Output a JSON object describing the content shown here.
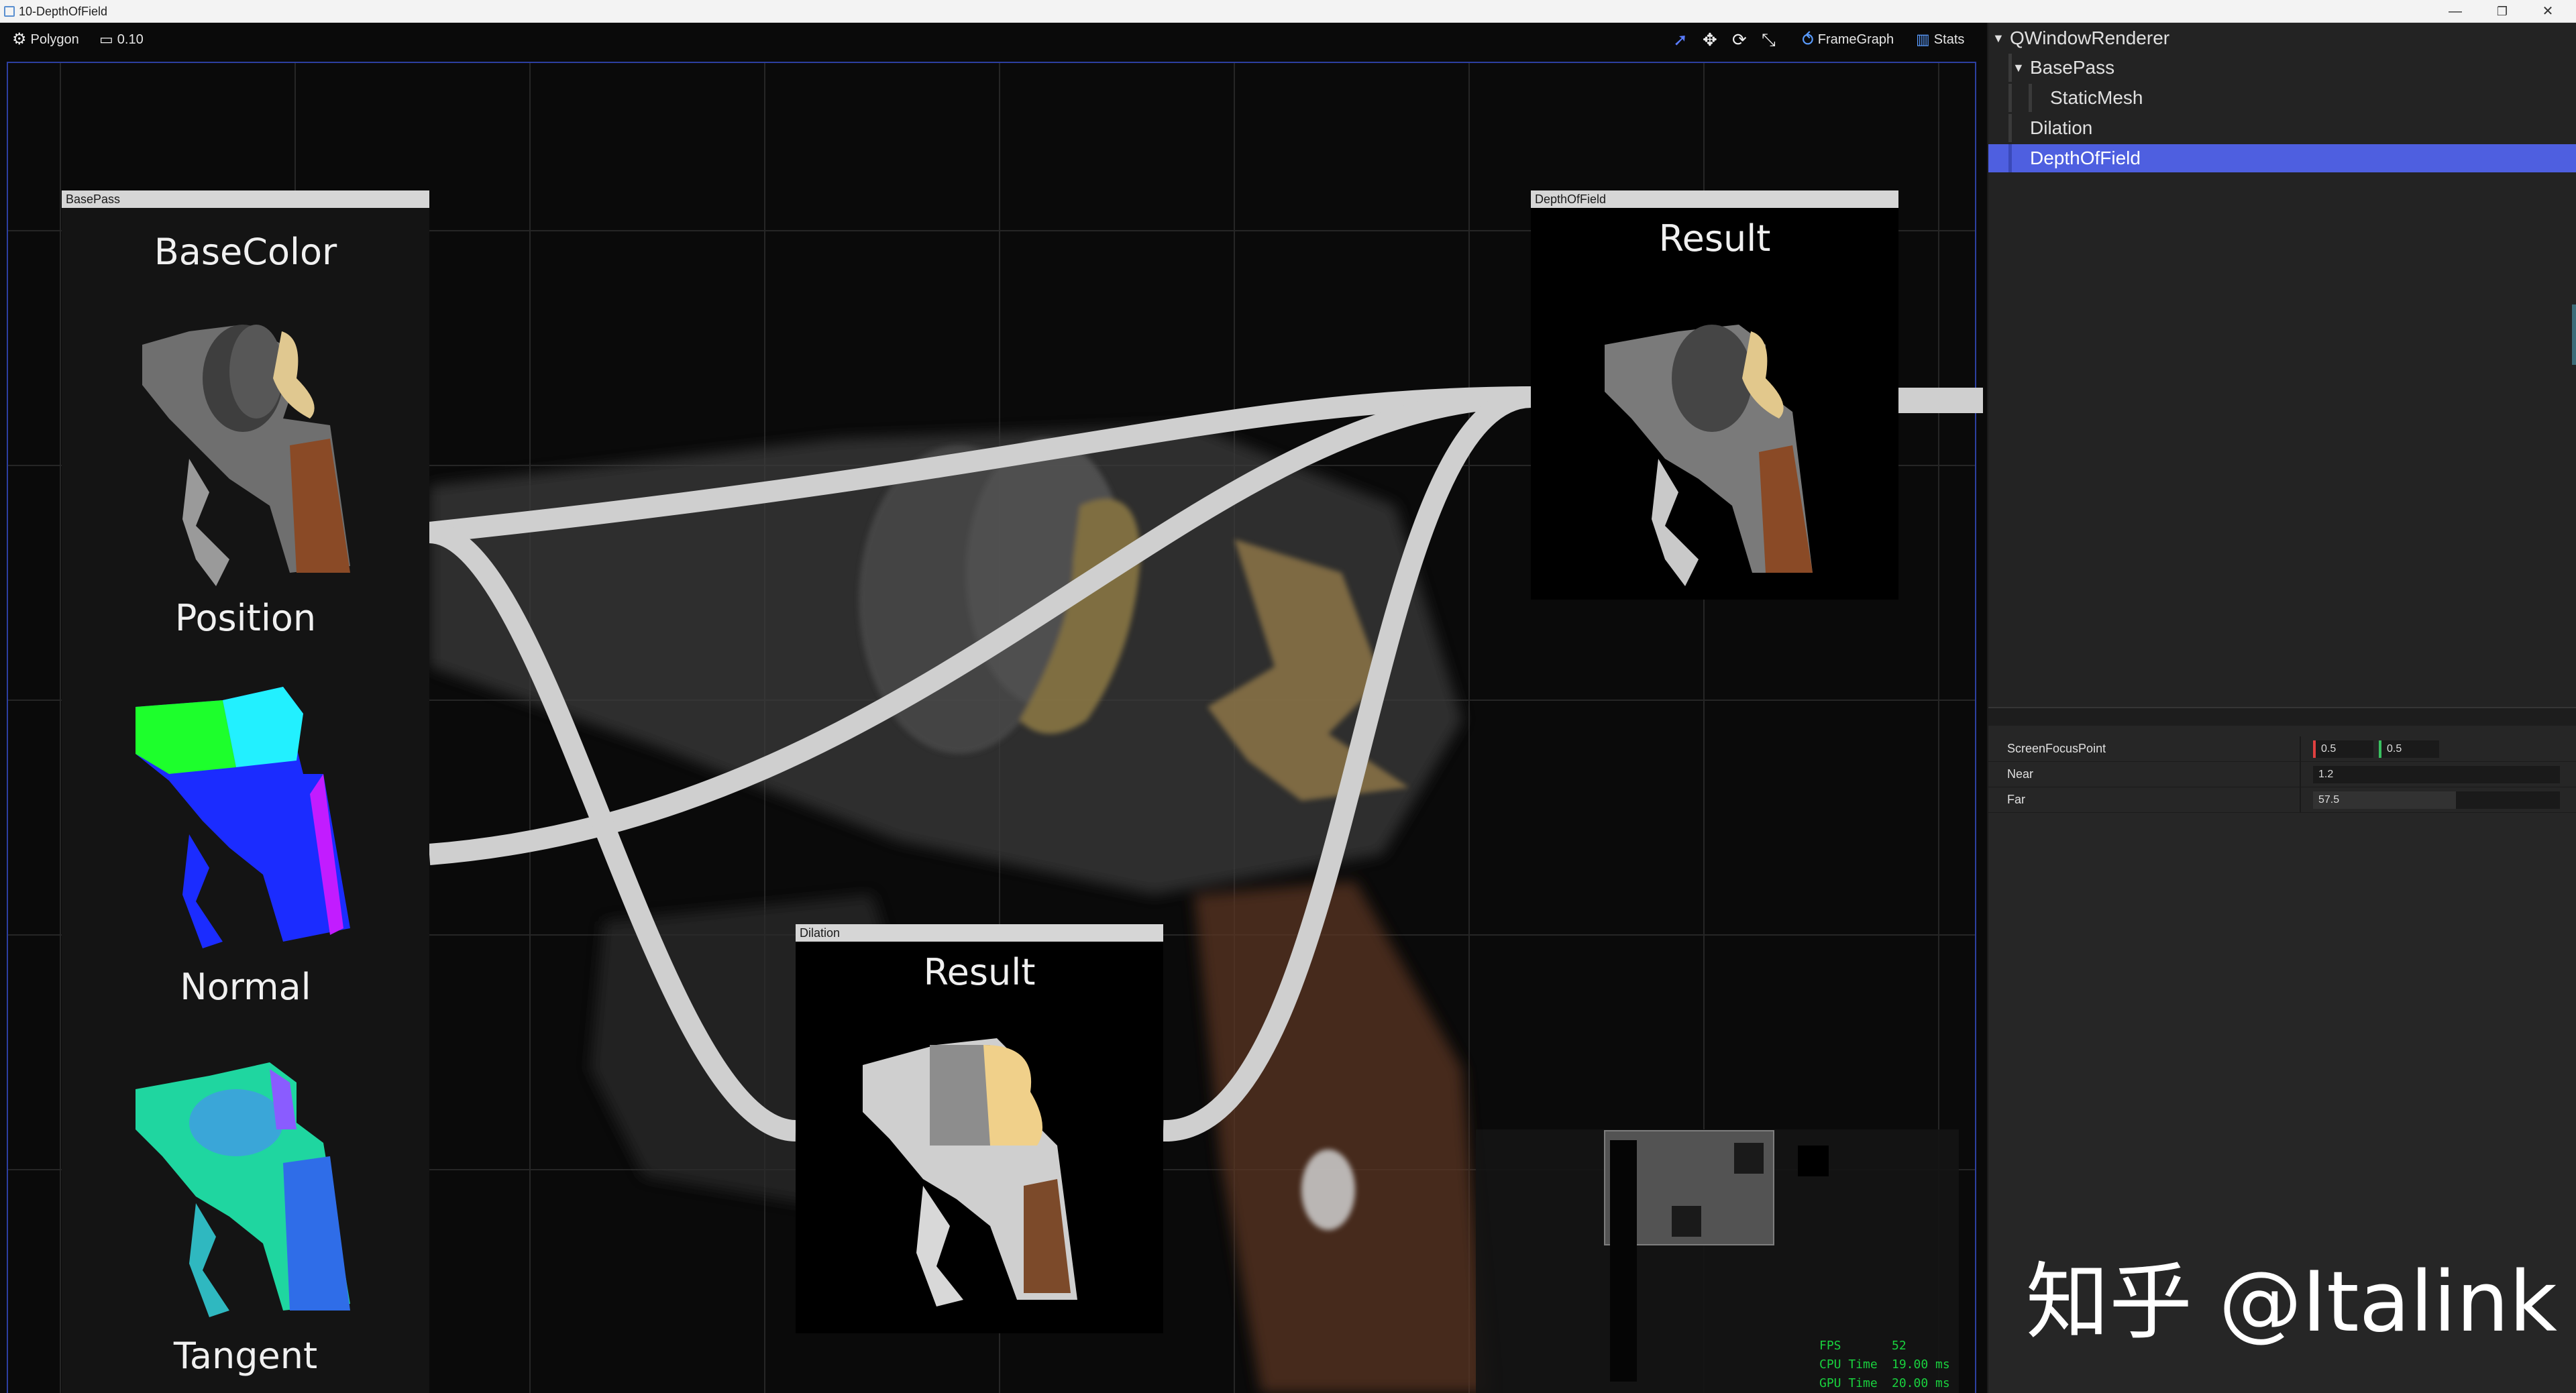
{
  "window": {
    "title": "10-DepthOfField"
  },
  "toolbar": {
    "mode_label": "Polygon",
    "camera_speed": "0.10",
    "framegraph_label": "FrameGraph",
    "stats_label": "Stats"
  },
  "nodes": {
    "basepass": {
      "header": "BasePass",
      "outputs": [
        "BaseColor",
        "Position",
        "Normal",
        "Tangent"
      ]
    },
    "dilation": {
      "header": "Dilation",
      "output": "Result"
    },
    "depthoffield": {
      "header": "DepthOfField",
      "output": "Result"
    }
  },
  "stats": {
    "fps_label": "FPS",
    "fps_value": "52",
    "cpu_label": "CPU Time",
    "cpu_value": "19.00 ms",
    "gpu_label": "GPU Time",
    "gpu_value": "20.00 ms"
  },
  "tree": {
    "items": [
      {
        "label": "QWindowRenderer"
      },
      {
        "label": "BasePass"
      },
      {
        "label": "StaticMesh"
      },
      {
        "label": "Dilation"
      },
      {
        "label": "DepthOfField",
        "selected": true
      }
    ]
  },
  "properties": {
    "screen_focus": {
      "name": "ScreenFocusPoint",
      "x": "0.5",
      "y": "0.5"
    },
    "near": {
      "name": "Near",
      "value": "1.2",
      "level": 0.0
    },
    "far": {
      "name": "Far",
      "value": "57.5",
      "level": 0.58
    }
  },
  "colors": {
    "selection": "#4e5fe0",
    "viewport_border": "#2c3fa0",
    "stats_green": "#19d13e",
    "edge": "#cfcfcf",
    "node_header": "#d6d6d6"
  },
  "watermark": "知乎 @Italink"
}
